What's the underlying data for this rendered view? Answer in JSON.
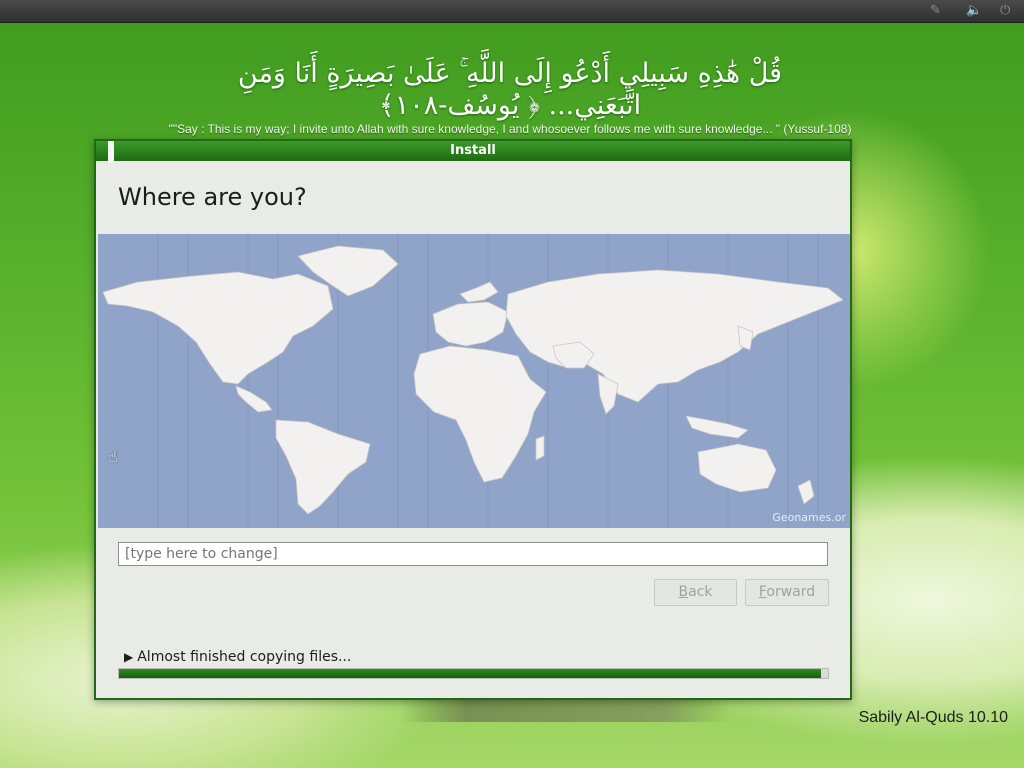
{
  "topbar": {
    "icons": [
      "network-icon",
      "volume-icon",
      "power-icon"
    ]
  },
  "header": {
    "verse": "قُلْ هَٰذِهِ سَبِيلِي أَدْعُو إِلَى اللَّهِ ۚ عَلَىٰ بَصِيرَةٍ أَنَا وَمَنِ اتَّبَعَنِي... ﴿ يُوسُف-١٠٨﴾",
    "translation": "\"\"Say : This is my way; I invite unto Allah with sure knowledge, I and whosoever follows me with sure knowledge... \" (Yussuf-108)"
  },
  "window": {
    "title": "Install",
    "heading": "Where are you?",
    "map_credit": "Geonames.or",
    "timezone_input": {
      "value": "",
      "placeholder": "[type here to change]"
    },
    "back": {
      "accel": "B",
      "rest": "ack"
    },
    "forward": {
      "accel": "F",
      "rest": "orward"
    },
    "status_text": "Almost finished copying files...",
    "progress_fraction": 0.99
  },
  "brand": "Sabily Al-Quds 10.10",
  "colors": {
    "accent": "#1f6a14",
    "map_ocean": "#8fa4c8",
    "land": "#f3f1ef"
  }
}
